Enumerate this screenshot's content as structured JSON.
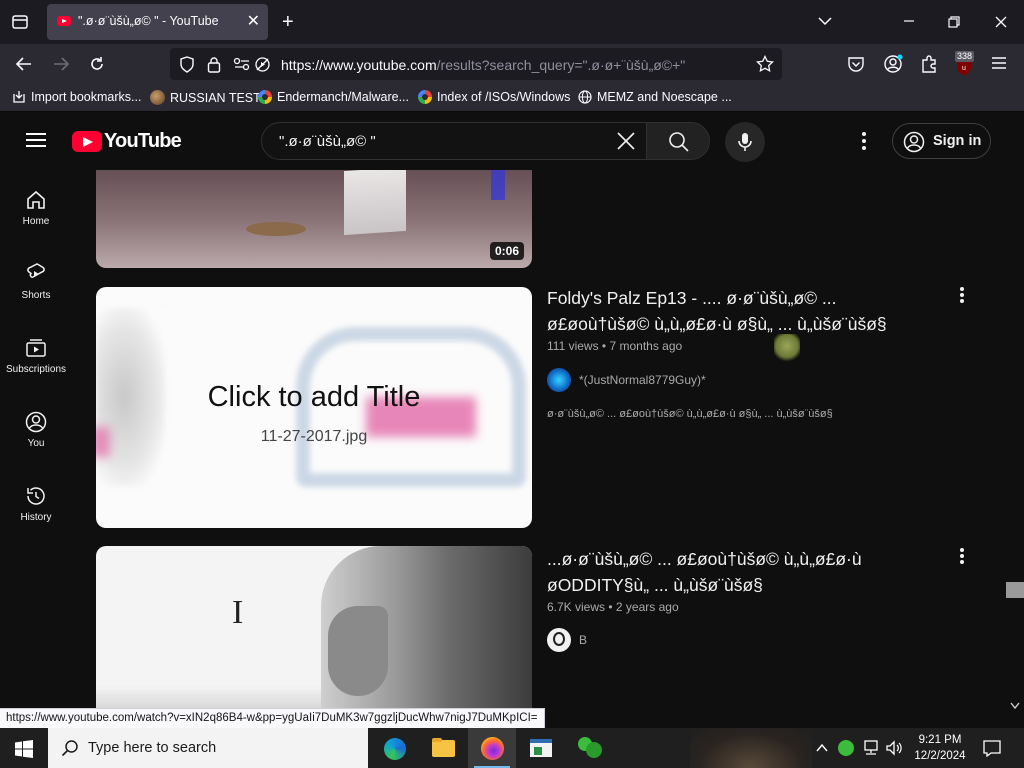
{
  "browser": {
    "tab_title": "\".ø·ø¨ùšù„ø© \" - YouTube",
    "url_host": "https://www.youtube.com",
    "url_rest": "/results?search_query=\".ø·ø+¨ùšù„ø©+\"",
    "extension_badge": "338",
    "bookmarks": [
      {
        "label": "Import bookmarks...",
        "icon": "import-icon"
      },
      {
        "label": "RUSSIAN TEST",
        "icon": "site-favicon"
      },
      {
        "label": "Endermanch/Malware...",
        "icon": "google-icon"
      },
      {
        "label": "Index of /ISOs/Windows",
        "icon": "google-icon"
      },
      {
        "label": "MEMZ and Noescape ...",
        "icon": "globe-icon"
      }
    ]
  },
  "youtube": {
    "logo_text": "YouTube",
    "search_query": "\".ø·ø¨ùšù„ø© \"",
    "signin_label": "Sign in",
    "sidebar": [
      {
        "label": "Home",
        "icon": "home-icon"
      },
      {
        "label": "Shorts",
        "icon": "shorts-icon"
      },
      {
        "label": "Subscriptions",
        "icon": "subscriptions-icon"
      },
      {
        "label": "You",
        "icon": "you-icon"
      },
      {
        "label": "History",
        "icon": "history-icon"
      }
    ],
    "results": [
      {
        "duration": "0:06"
      },
      {
        "title": "Foldy's Palz Ep13 - .... ø·ø¨ùšù„ø© ... ø£øoù†ùšø© ù„ù„ø£ø·ù ø§ù„ ... ù„ùšø¨ùšø§",
        "views": "111 views",
        "age": "7 months ago",
        "channel": "*(JustNormal8779Guy)*",
        "description": "ø·ø¨ùšù„ø© ... ø£øoù†ùšø© ù„ù„ø£ø·ù ø§ù„ ... ù„ùšø¨ùšø§",
        "thumb_title": "Click to add Title",
        "thumb_subtitle": "11-27-2017.jpg"
      },
      {
        "title": "...ø·ø¨ùšù„ø© ... ø£øoù†ùšø© ù„ù„ø£ø·ù øODDITY§ù„ ... ù„ùšø¨ùšø§",
        "views": "6.7K views",
        "age": "2 years ago",
        "channel": "B",
        "thumb_letter": "I"
      }
    ]
  },
  "status_url": "https://www.youtube.com/watch?v=xIN2q86B4-w&pp=ygUaIi7DuMK3w7ggzljDucWhw7nigJ7DuMKpICI=",
  "taskbar": {
    "search_placeholder": "Type here to search",
    "time": "9:21 PM",
    "date": "12/2/2024"
  }
}
